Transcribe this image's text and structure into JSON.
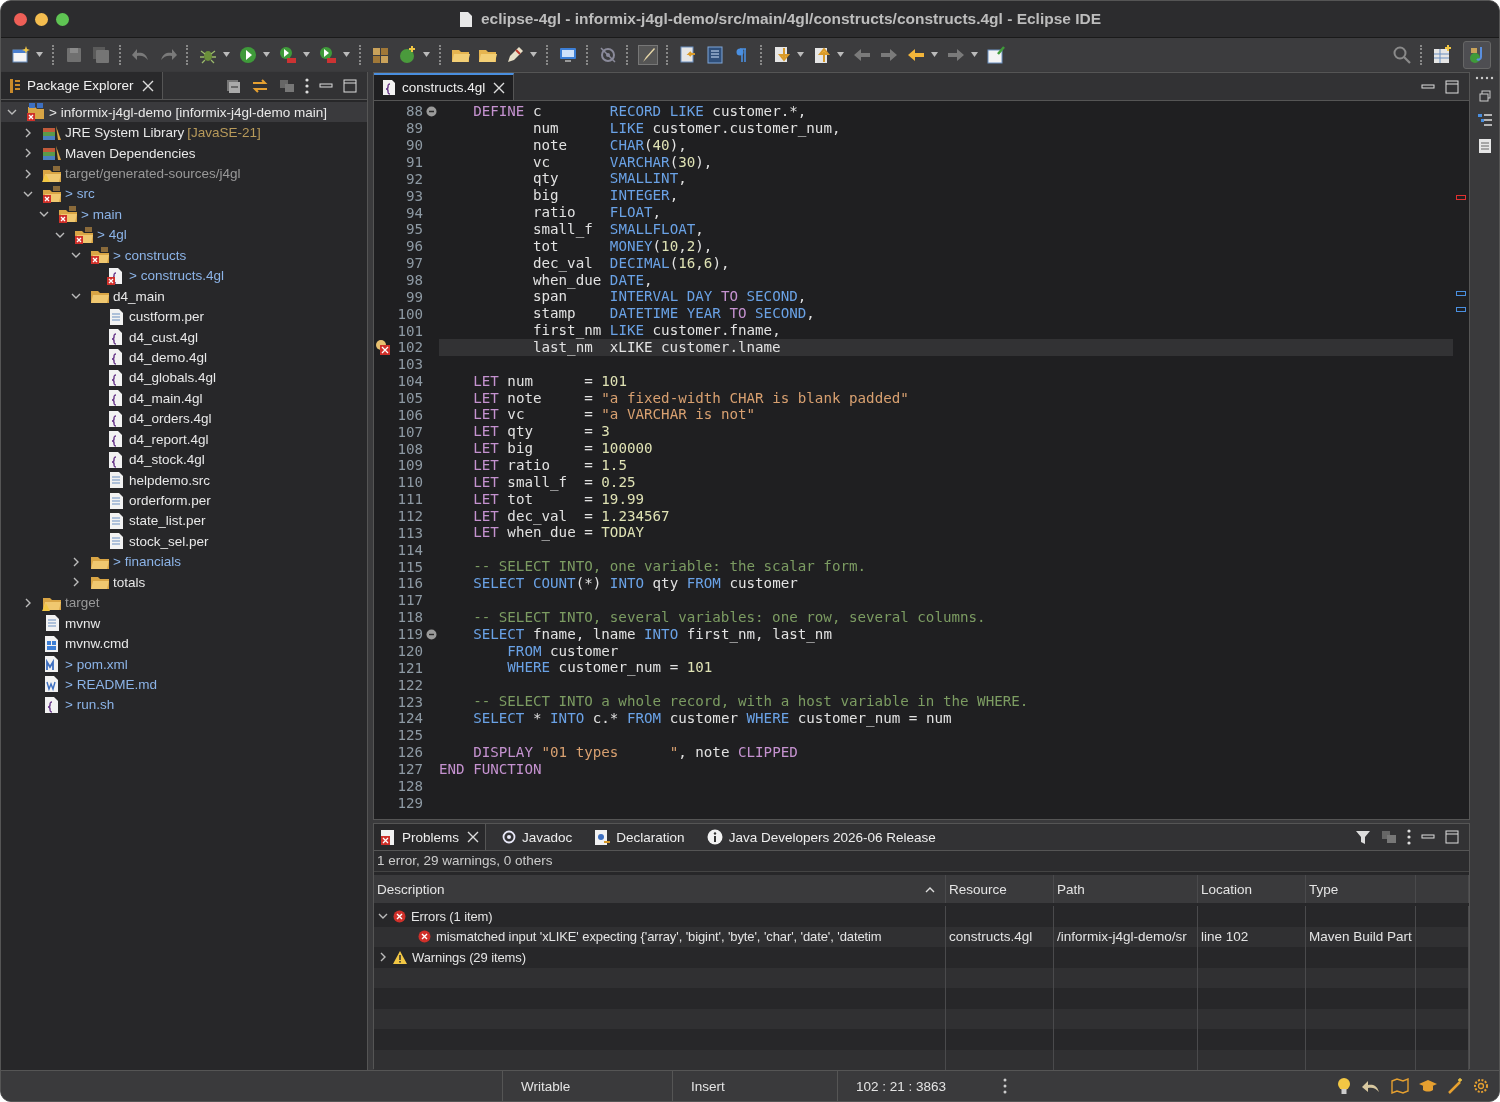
{
  "window": {
    "title": "eclipse-4gl - informix-j4gl-demo/src/main/4gl/constructs/constructs.4gl - Eclipse IDE"
  },
  "package_explorer": {
    "tab": {
      "label": "Package Explorer",
      "selected": true
    },
    "tree": [
      {
        "label": "> informix-j4gl-demo [informix-j4gl-demo main]",
        "kind": "project",
        "changed": false,
        "derived": false,
        "error": true,
        "warning": false,
        "expanded": true,
        "selected": true,
        "children": [
          {
            "label": "JRE System Library",
            "decoration": "[JavaSE-21]",
            "kind": "library",
            "changed": false,
            "derived": false,
            "error": false,
            "warning": false,
            "expanded": false,
            "selected": false
          },
          {
            "label": "Maven Dependencies",
            "kind": "library",
            "changed": false,
            "derived": false,
            "error": false,
            "warning": false,
            "expanded": false,
            "selected": false
          },
          {
            "label": "target/generated-sources/j4gl",
            "kind": "package",
            "changed": false,
            "derived": true,
            "error": false,
            "warning": true,
            "expanded": false,
            "selected": false
          },
          {
            "label": "> src",
            "kind": "package",
            "changed": true,
            "derived": false,
            "error": true,
            "warning": false,
            "expanded": true,
            "selected": false,
            "children": [
              {
                "label": "> main",
                "kind": "package",
                "changed": true,
                "derived": false,
                "error": true,
                "warning": false,
                "expanded": true,
                "selected": false,
                "children": [
                  {
                    "label": "> 4gl",
                    "kind": "package",
                    "changed": true,
                    "derived": false,
                    "error": true,
                    "warning": false,
                    "expanded": true,
                    "selected": false,
                    "children": [
                      {
                        "label": "> constructs",
                        "kind": "package",
                        "changed": true,
                        "derived": false,
                        "error": true,
                        "warning": false,
                        "expanded": true,
                        "selected": false,
                        "children": [
                          {
                            "label": "> constructs.4gl",
                            "kind": "code",
                            "changed": true,
                            "derived": false,
                            "error": true,
                            "warning": false,
                            "selected": false
                          }
                        ]
                      },
                      {
                        "label": "d4_main",
                        "kind": "folder",
                        "changed": false,
                        "derived": false,
                        "error": false,
                        "warning": false,
                        "expanded": true,
                        "selected": false,
                        "children": [
                          {
                            "label": "custform.per",
                            "kind": "text",
                            "changed": false,
                            "derived": false,
                            "error": false,
                            "warning": false,
                            "selected": false
                          },
                          {
                            "label": "d4_cust.4gl",
                            "kind": "code",
                            "changed": false,
                            "derived": false,
                            "error": false,
                            "warning": false,
                            "selected": false
                          },
                          {
                            "label": "d4_demo.4gl",
                            "kind": "code",
                            "changed": false,
                            "derived": false,
                            "error": false,
                            "warning": false,
                            "selected": false
                          },
                          {
                            "label": "d4_globals.4gl",
                            "kind": "code",
                            "changed": false,
                            "derived": false,
                            "error": false,
                            "warning": false,
                            "selected": false
                          },
                          {
                            "label": "d4_main.4gl",
                            "kind": "code",
                            "changed": false,
                            "derived": false,
                            "error": false,
                            "warning": false,
                            "selected": false
                          },
                          {
                            "label": "d4_orders.4gl",
                            "kind": "code",
                            "changed": false,
                            "derived": false,
                            "error": false,
                            "warning": false,
                            "selected": false
                          },
                          {
                            "label": "d4_report.4gl",
                            "kind": "code",
                            "changed": false,
                            "derived": false,
                            "error": false,
                            "warning": false,
                            "selected": false
                          },
                          {
                            "label": "d4_stock.4gl",
                            "kind": "code",
                            "changed": false,
                            "derived": false,
                            "error": false,
                            "warning": false,
                            "selected": false
                          },
                          {
                            "label": "helpdemo.src",
                            "kind": "text",
                            "changed": false,
                            "derived": false,
                            "error": false,
                            "warning": false,
                            "selected": false
                          },
                          {
                            "label": "orderform.per",
                            "kind": "text",
                            "changed": false,
                            "derived": false,
                            "error": false,
                            "warning": false,
                            "selected": false
                          },
                          {
                            "label": "state_list.per",
                            "kind": "text",
                            "changed": false,
                            "derived": false,
                            "error": false,
                            "warning": false,
                            "selected": false
                          },
                          {
                            "label": "stock_sel.per",
                            "kind": "text",
                            "changed": false,
                            "derived": false,
                            "error": false,
                            "warning": false,
                            "selected": false
                          }
                        ]
                      },
                      {
                        "label": "> financials",
                        "kind": "folder",
                        "changed": true,
                        "derived": false,
                        "error": false,
                        "warning": false,
                        "expanded": false,
                        "selected": false
                      },
                      {
                        "label": "totals",
                        "kind": "folder",
                        "changed": false,
                        "derived": false,
                        "error": false,
                        "warning": false,
                        "expanded": false,
                        "selected": false
                      }
                    ]
                  }
                ]
              }
            ]
          },
          {
            "label": "target",
            "kind": "folder",
            "changed": false,
            "derived": true,
            "error": false,
            "warning": true,
            "expanded": false,
            "selected": false
          },
          {
            "label": "mvnw",
            "kind": "text",
            "changed": false,
            "derived": false,
            "error": false,
            "warning": false,
            "selected": false
          },
          {
            "label": "mvnw.cmd",
            "kind": "cmd",
            "changed": false,
            "derived": false,
            "error": false,
            "warning": false,
            "selected": false
          },
          {
            "label": "> pom.xml",
            "kind": "xml",
            "changed": true,
            "derived": false,
            "error": false,
            "warning": false,
            "selected": false
          },
          {
            "label": "> README.md",
            "kind": "doc",
            "changed": true,
            "derived": false,
            "error": false,
            "warning": false,
            "selected": false
          },
          {
            "label": "> run.sh",
            "kind": "code",
            "changed": true,
            "derived": false,
            "error": false,
            "warning": false,
            "selected": false
          }
        ]
      }
    ]
  },
  "editor": {
    "tabs": [
      {
        "label": "constructs.4gl",
        "selected": true
      }
    ],
    "lines": [
      {
        "number": "88",
        "fold": true,
        "tokens": [
          {
            "kind": "k",
            "t": "    DEFINE"
          },
          {
            "kind": "p",
            "t": " c        "
          },
          {
            "kind": "b",
            "t": "RECORD LIKE"
          },
          {
            "kind": "p",
            "t": " customer.*,"
          }
        ]
      },
      {
        "number": "89",
        "tokens": [
          {
            "kind": "p",
            "t": "           num      "
          },
          {
            "kind": "b",
            "t": "LIKE"
          },
          {
            "kind": "p",
            "t": " customer.customer_num,"
          }
        ]
      },
      {
        "number": "90",
        "tokens": [
          {
            "kind": "p",
            "t": "           note     "
          },
          {
            "kind": "b",
            "t": "CHAR"
          },
          {
            "kind": "p",
            "t": "("
          },
          {
            "kind": "n",
            "t": "40"
          },
          {
            "kind": "p",
            "t": "),"
          }
        ]
      },
      {
        "number": "91",
        "tokens": [
          {
            "kind": "p",
            "t": "           vc       "
          },
          {
            "kind": "b",
            "t": "VARCHAR"
          },
          {
            "kind": "p",
            "t": "("
          },
          {
            "kind": "n",
            "t": "30"
          },
          {
            "kind": "p",
            "t": "),"
          }
        ]
      },
      {
        "number": "92",
        "tokens": [
          {
            "kind": "p",
            "t": "           qty      "
          },
          {
            "kind": "b",
            "t": "SMALLINT"
          },
          {
            "kind": "p",
            "t": ","
          }
        ]
      },
      {
        "number": "93",
        "tokens": [
          {
            "kind": "p",
            "t": "           big      "
          },
          {
            "kind": "b",
            "t": "INTEGER"
          },
          {
            "kind": "p",
            "t": ","
          }
        ]
      },
      {
        "number": "94",
        "tokens": [
          {
            "kind": "p",
            "t": "           ratio    "
          },
          {
            "kind": "b",
            "t": "FLOAT"
          },
          {
            "kind": "p",
            "t": ","
          }
        ]
      },
      {
        "number": "95",
        "tokens": [
          {
            "kind": "p",
            "t": "           small_f  "
          },
          {
            "kind": "b",
            "t": "SMALLFLOAT"
          },
          {
            "kind": "p",
            "t": ","
          }
        ]
      },
      {
        "number": "96",
        "tokens": [
          {
            "kind": "p",
            "t": "           tot      "
          },
          {
            "kind": "b",
            "t": "MONEY"
          },
          {
            "kind": "p",
            "t": "("
          },
          {
            "kind": "n",
            "t": "10"
          },
          {
            "kind": "p",
            "t": ","
          },
          {
            "kind": "n",
            "t": "2"
          },
          {
            "kind": "p",
            "t": "),"
          }
        ]
      },
      {
        "number": "97",
        "tokens": [
          {
            "kind": "p",
            "t": "           dec_val  "
          },
          {
            "kind": "b",
            "t": "DECIMAL"
          },
          {
            "kind": "p",
            "t": "("
          },
          {
            "kind": "n",
            "t": "16"
          },
          {
            "kind": "p",
            "t": ","
          },
          {
            "kind": "n",
            "t": "6"
          },
          {
            "kind": "p",
            "t": "),"
          }
        ]
      },
      {
        "number": "98",
        "tokens": [
          {
            "kind": "p",
            "t": "           when_due "
          },
          {
            "kind": "b",
            "t": "DATE"
          },
          {
            "kind": "p",
            "t": ","
          }
        ]
      },
      {
        "number": "99",
        "tokens": [
          {
            "kind": "p",
            "t": "           span     "
          },
          {
            "kind": "b",
            "t": "INTERVAL DAY "
          },
          {
            "kind": "k",
            "t": "TO"
          },
          {
            "kind": "b",
            "t": " SECOND"
          },
          {
            "kind": "p",
            "t": ","
          }
        ]
      },
      {
        "number": "100",
        "tokens": [
          {
            "kind": "p",
            "t": "           stamp    "
          },
          {
            "kind": "b",
            "t": "DATETIME YEAR "
          },
          {
            "kind": "k",
            "t": "TO"
          },
          {
            "kind": "b",
            "t": " SECOND"
          },
          {
            "kind": "p",
            "t": ","
          }
        ]
      },
      {
        "number": "101",
        "tokens": [
          {
            "kind": "p",
            "t": "           first_nm "
          },
          {
            "kind": "b",
            "t": "LIKE"
          },
          {
            "kind": "p",
            "t": " customer.fname,"
          }
        ]
      },
      {
        "number": "102",
        "error": true,
        "current": true,
        "tokens": [
          {
            "kind": "p",
            "t": "           last_nm  xLIKE customer.lname"
          }
        ]
      },
      {
        "number": "103"
      },
      {
        "number": "104",
        "tokens": [
          {
            "kind": "k",
            "t": "    LET"
          },
          {
            "kind": "p",
            "t": " num      = "
          },
          {
            "kind": "n",
            "t": "101"
          }
        ]
      },
      {
        "number": "105",
        "tokens": [
          {
            "kind": "k",
            "t": "    LET"
          },
          {
            "kind": "p",
            "t": " note     = "
          },
          {
            "kind": "s",
            "t": "\"a fixed-width CHAR is blank padded\""
          }
        ]
      },
      {
        "number": "106",
        "tokens": [
          {
            "kind": "k",
            "t": "    LET"
          },
          {
            "kind": "p",
            "t": " vc       = "
          },
          {
            "kind": "s",
            "t": "\"a VARCHAR is not\""
          }
        ]
      },
      {
        "number": "107",
        "tokens": [
          {
            "kind": "k",
            "t": "    LET"
          },
          {
            "kind": "p",
            "t": " qty      = "
          },
          {
            "kind": "n",
            "t": "3"
          }
        ]
      },
      {
        "number": "108",
        "tokens": [
          {
            "kind": "k",
            "t": "    LET"
          },
          {
            "kind": "p",
            "t": " big      = "
          },
          {
            "kind": "n",
            "t": "100000"
          }
        ]
      },
      {
        "number": "109",
        "tokens": [
          {
            "kind": "k",
            "t": "    LET"
          },
          {
            "kind": "p",
            "t": " ratio    = "
          },
          {
            "kind": "n",
            "t": "1.5"
          }
        ]
      },
      {
        "number": "110",
        "tokens": [
          {
            "kind": "k",
            "t": "    LET"
          },
          {
            "kind": "p",
            "t": " small_f  = "
          },
          {
            "kind": "n",
            "t": "0.25"
          }
        ]
      },
      {
        "number": "111",
        "tokens": [
          {
            "kind": "k",
            "t": "    LET"
          },
          {
            "kind": "p",
            "t": " tot      = "
          },
          {
            "kind": "n",
            "t": "19.99"
          }
        ]
      },
      {
        "number": "112",
        "tokens": [
          {
            "kind": "k",
            "t": "    LET"
          },
          {
            "kind": "p",
            "t": " dec_val  = "
          },
          {
            "kind": "n",
            "t": "1.234567"
          }
        ]
      },
      {
        "number": "113",
        "tokens": [
          {
            "kind": "k",
            "t": "    LET"
          },
          {
            "kind": "p",
            "t": " when_due = "
          },
          {
            "kind": "n",
            "t": "TODAY"
          }
        ]
      },
      {
        "number": "114"
      },
      {
        "number": "115",
        "tokens": [
          {
            "kind": "c",
            "t": "    -- SELECT INTO, one variable: the scalar form."
          }
        ]
      },
      {
        "number": "116",
        "tokens": [
          {
            "kind": "b",
            "t": "    SELECT COUNT"
          },
          {
            "kind": "p",
            "t": "(*) "
          },
          {
            "kind": "b",
            "t": "INTO"
          },
          {
            "kind": "p",
            "t": " qty "
          },
          {
            "kind": "b",
            "t": "FROM"
          },
          {
            "kind": "p",
            "t": " customer"
          }
        ]
      },
      {
        "number": "117"
      },
      {
        "number": "118",
        "tokens": [
          {
            "kind": "c",
            "t": "    -- SELECT INTO, several variables: one row, several columns."
          }
        ]
      },
      {
        "number": "119",
        "fold": true,
        "tokens": [
          {
            "kind": "b",
            "t": "    SELECT"
          },
          {
            "kind": "p",
            "t": " fname, lname "
          },
          {
            "kind": "b",
            "t": "INTO"
          },
          {
            "kind": "p",
            "t": " first_nm, last_nm"
          }
        ]
      },
      {
        "number": "120",
        "tokens": [
          {
            "kind": "b",
            "t": "        FROM"
          },
          {
            "kind": "p",
            "t": " customer"
          }
        ]
      },
      {
        "number": "121",
        "tokens": [
          {
            "kind": "b",
            "t": "        WHERE"
          },
          {
            "kind": "p",
            "t": " customer_num = "
          },
          {
            "kind": "n",
            "t": "101"
          }
        ]
      },
      {
        "number": "122"
      },
      {
        "number": "123",
        "tokens": [
          {
            "kind": "c",
            "t": "    -- SELECT INTO a whole record, with a host variable in the WHERE."
          }
        ]
      },
      {
        "number": "124",
        "tokens": [
          {
            "kind": "b",
            "t": "    SELECT"
          },
          {
            "kind": "p",
            "t": " * "
          },
          {
            "kind": "b",
            "t": "INTO"
          },
          {
            "kind": "p",
            "t": " c.* "
          },
          {
            "kind": "b",
            "t": "FROM"
          },
          {
            "kind": "p",
            "t": " customer "
          },
          {
            "kind": "b",
            "t": "WHERE"
          },
          {
            "kind": "p",
            "t": " customer_num = num"
          }
        ]
      },
      {
        "number": "125"
      },
      {
        "number": "126",
        "tokens": [
          {
            "kind": "k",
            "t": "    DISPLAY"
          },
          {
            "kind": "s",
            "t": " \"01 types      \""
          },
          {
            "kind": "p",
            "t": ", note "
          },
          {
            "kind": "k",
            "t": "CLIPPED"
          }
        ]
      },
      {
        "number": "127",
        "tokens": [
          {
            "kind": "k",
            "t": "END FUNCTION"
          }
        ]
      },
      {
        "number": "128"
      },
      {
        "number": "129"
      }
    ]
  },
  "problems": {
    "tabs": [
      {
        "label": "Problems",
        "kind": "problems",
        "selected": true
      },
      {
        "label": "Javadoc",
        "kind": "javadoc",
        "selected": false
      },
      {
        "label": "Declaration",
        "kind": "declaration",
        "selected": false
      },
      {
        "label": "Java Developers 2026-06 Release",
        "kind": "info",
        "selected": false
      }
    ],
    "summary": "1 error, 29 warnings, 0 others",
    "columns": [
      "Description",
      "Resource",
      "Path",
      "Location",
      "Type"
    ],
    "rows": [
      {
        "kind": "error_group",
        "expanded": true,
        "description": "Errors (1 item)"
      },
      {
        "kind": "error_item",
        "description": "mismatched input 'xLIKE' expecting {'array', 'bigint', 'byte', 'char', 'date', 'datetim",
        "resource": "constructs.4gl",
        "path": "/informix-j4gl-demo/sr",
        "location": "line 102",
        "type": "Maven Build Part"
      },
      {
        "kind": "warning_group",
        "expanded": false,
        "description": "Warnings (29 items)"
      }
    ]
  },
  "status_bar": {
    "fields": [
      "Writable",
      "Insert",
      "102 : 21 : 3863"
    ]
  }
}
